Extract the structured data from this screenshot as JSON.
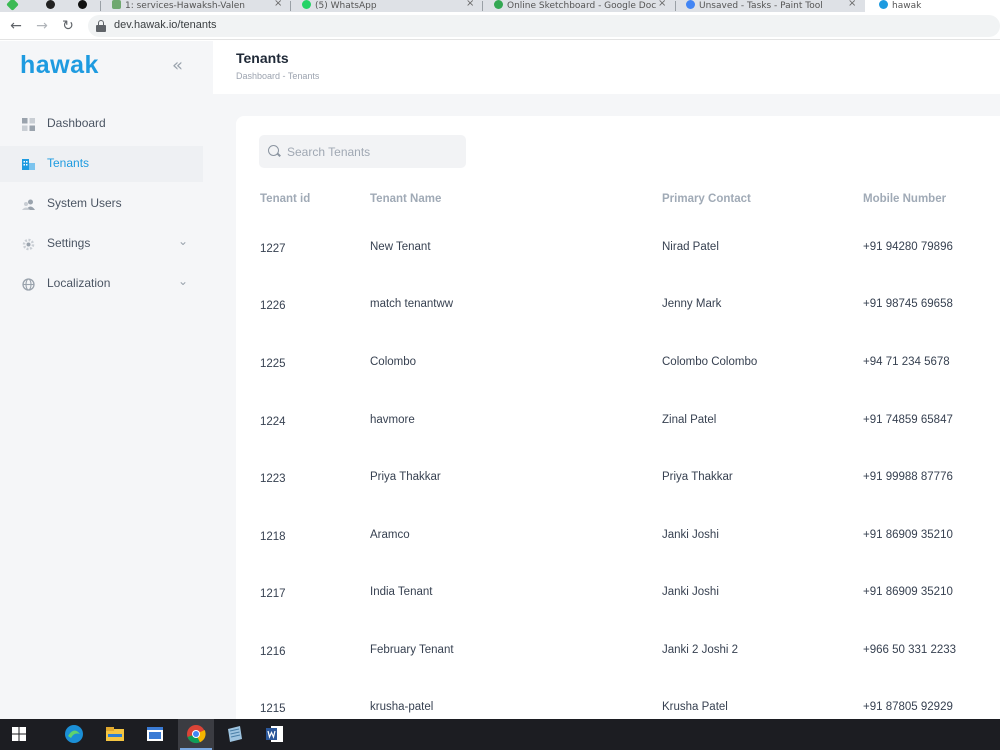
{
  "browser": {
    "tabs": [
      {
        "label": "1: services-Hawaksh-Valen",
        "color": "#3cba54"
      },
      {
        "label": "(5) WhatsApp",
        "color": "#25d366"
      },
      {
        "label": "Online Sketchboard - Google Doc",
        "color": "#34a853"
      },
      {
        "label": "Unsaved - Tasks - Paint Tool",
        "color": "#4285f4"
      },
      {
        "label": "hawak",
        "color": "#1e9be0"
      }
    ],
    "close_glyph": "×",
    "back_glyph": "←",
    "forward_glyph": "→",
    "reload_glyph": "↻",
    "url": "dev.hawak.io/tenants"
  },
  "sidebar": {
    "logo": "hawak",
    "collapse_glyph": "«",
    "chevron_glyph": "⌄",
    "items": [
      {
        "label": "Dashboard",
        "icon": "dashboard-icon",
        "active": false,
        "has_chevron": false
      },
      {
        "label": "Tenants",
        "icon": "tenants-icon",
        "active": true,
        "has_chevron": false
      },
      {
        "label": "System Users",
        "icon": "users-icon",
        "active": false,
        "has_chevron": false
      },
      {
        "label": "Settings",
        "icon": "gear-icon",
        "active": false,
        "has_chevron": true
      },
      {
        "label": "Localization",
        "icon": "globe-icon",
        "active": false,
        "has_chevron": true
      }
    ]
  },
  "header": {
    "title": "Tenants",
    "breadcrumb": "Dashboard - Tenants"
  },
  "search": {
    "placeholder": "Search Tenants",
    "value": ""
  },
  "table": {
    "columns": [
      "Tenant id",
      "Tenant Name",
      "Primary Contact",
      "Mobile Number"
    ],
    "rows": [
      {
        "id": "1227",
        "name": "New Tenant",
        "contact": "Nirad Patel",
        "mobile": "+91 94280 79896"
      },
      {
        "id": "1226",
        "name": "match tenantww",
        "contact": "Jenny Mark",
        "mobile": "+91 98745 69658"
      },
      {
        "id": "1225",
        "name": "Colombo",
        "contact": "Colombo Colombo",
        "mobile": "+94 71 234 5678"
      },
      {
        "id": "1224",
        "name": "havmore",
        "contact": "Zinal Patel",
        "mobile": "+91 74859 65847"
      },
      {
        "id": "1223",
        "name": "Priya Thakkar",
        "contact": "Priya Thakkar",
        "mobile": "+91 99988 87776"
      },
      {
        "id": "1218",
        "name": "Aramco",
        "contact": "Janki Joshi",
        "mobile": "+91 86909 35210"
      },
      {
        "id": "1217",
        "name": "India Tenant",
        "contact": "Janki Joshi",
        "mobile": "+91 86909 35210"
      },
      {
        "id": "1216",
        "name": "February Tenant",
        "contact": "Janki 2 Joshi 2",
        "mobile": "+966 50 331 2233"
      },
      {
        "id": "1215",
        "name": "krusha-patel",
        "contact": "Krusha Patel",
        "mobile": "+91 87805 92929"
      }
    ]
  },
  "taskbar": {
    "apps": [
      "windows-start-icon",
      "edge-icon",
      "file-explorer-icon",
      "window-app-icon",
      "chrome-icon",
      "notes-app-icon",
      "word-icon"
    ]
  },
  "colors": {
    "brand": "#1e9be0",
    "sidebar_bg": "#f5f6f8",
    "header_text": "#a0aab6"
  }
}
